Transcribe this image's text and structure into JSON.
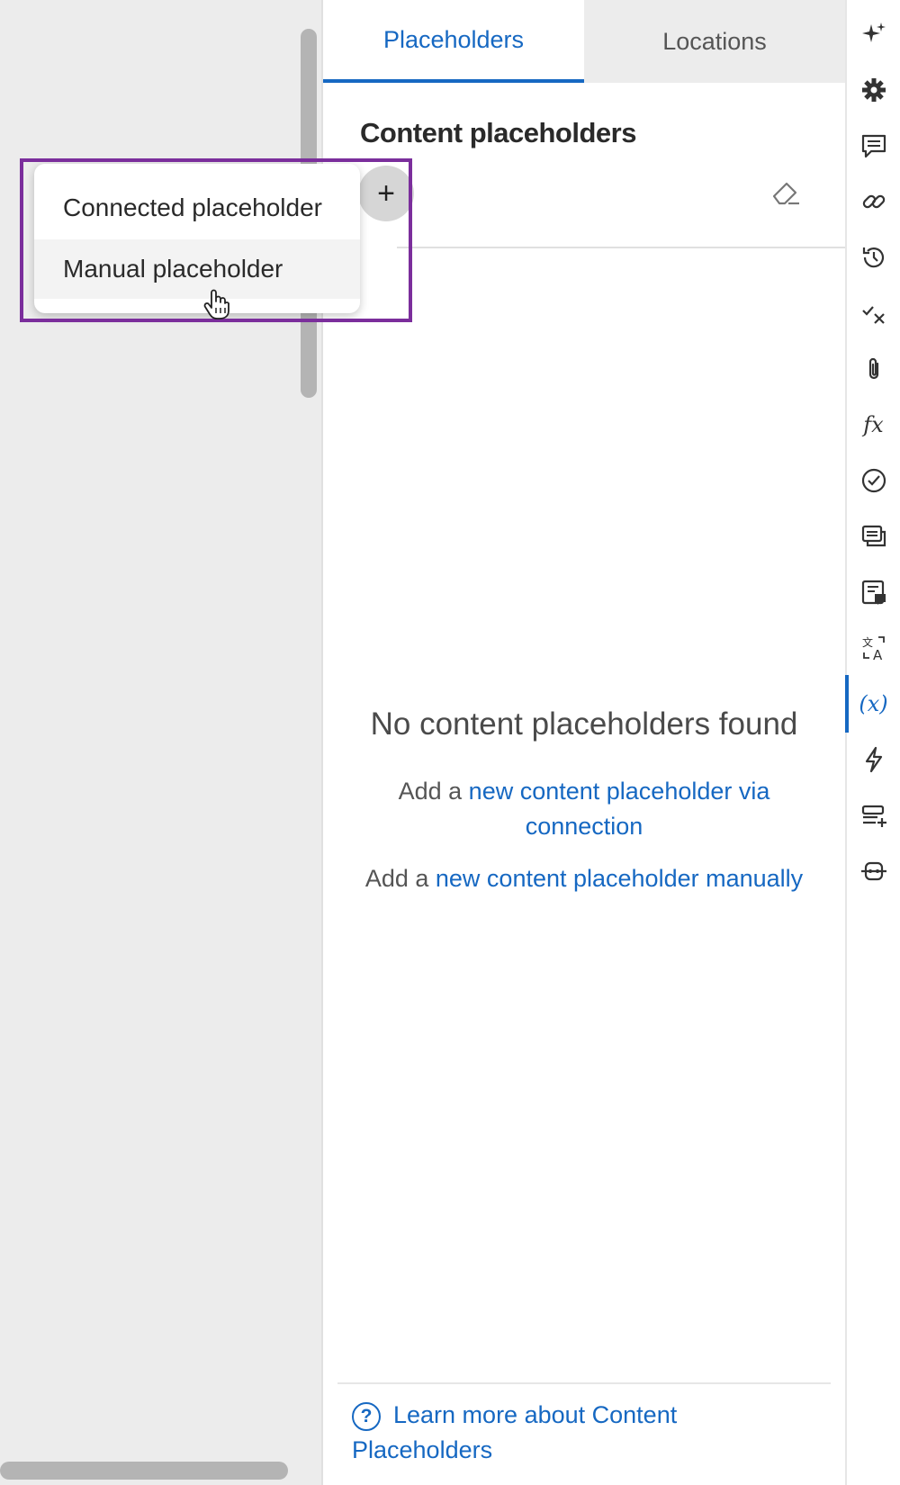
{
  "tabs": {
    "placeholders": "Placeholders",
    "locations": "Locations"
  },
  "section": {
    "title": "Content placeholders"
  },
  "add_menu": {
    "items": [
      "Connected placeholder",
      "Manual placeholder"
    ],
    "hovered": "Manual placeholder",
    "add_button_icon": "plus-icon"
  },
  "empty_state": {
    "title": "No content placeholders found",
    "connection_prefix": "Add a ",
    "connection_link": "new content placeholder via connection",
    "manual_prefix": "Add a ",
    "manual_link": "new content placeholder manually"
  },
  "footer": {
    "help_icon": "?",
    "help_link": "Learn more about Content Placeholders"
  },
  "rail": {
    "icons": [
      "sparkles-icon",
      "gear-icon",
      "comment-icon",
      "link-icon",
      "history-icon",
      "check-x-icon",
      "paperclip-icon",
      "function-icon",
      "check-circle-icon",
      "messages-icon",
      "note-icon",
      "translate-icon",
      "variable-icon",
      "lightning-icon",
      "list-add-icon",
      "connector-icon"
    ],
    "active": "variable-icon",
    "fx_label": "fx",
    "var_label": "(x)"
  },
  "colors": {
    "accent": "#1668c2",
    "highlight": "#7b2e9c"
  }
}
